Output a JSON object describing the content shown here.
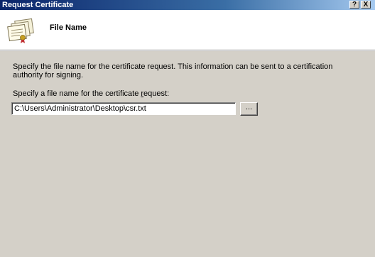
{
  "window": {
    "title": "Request Certificate",
    "help_glyph": "?",
    "close_glyph": "X"
  },
  "header": {
    "icon": "certificate-stack-icon",
    "title": "File Name"
  },
  "main": {
    "description": "Specify the file name for the certificate request. This information can be sent to a certification authority for signing.",
    "label_prefix": "Specify a file name for the certificate ",
    "label_underlined": "r",
    "label_suffix": "equest:",
    "file_name_value": "C:\\Users\\Administrator\\Desktop\\csr.txt",
    "browse_label": "..."
  },
  "colors": {
    "title_bar_start": "#0a246a",
    "title_bar_end": "#a6caf0",
    "dialog_background": "#d4d0c8",
    "header_background": "#ffffff"
  }
}
